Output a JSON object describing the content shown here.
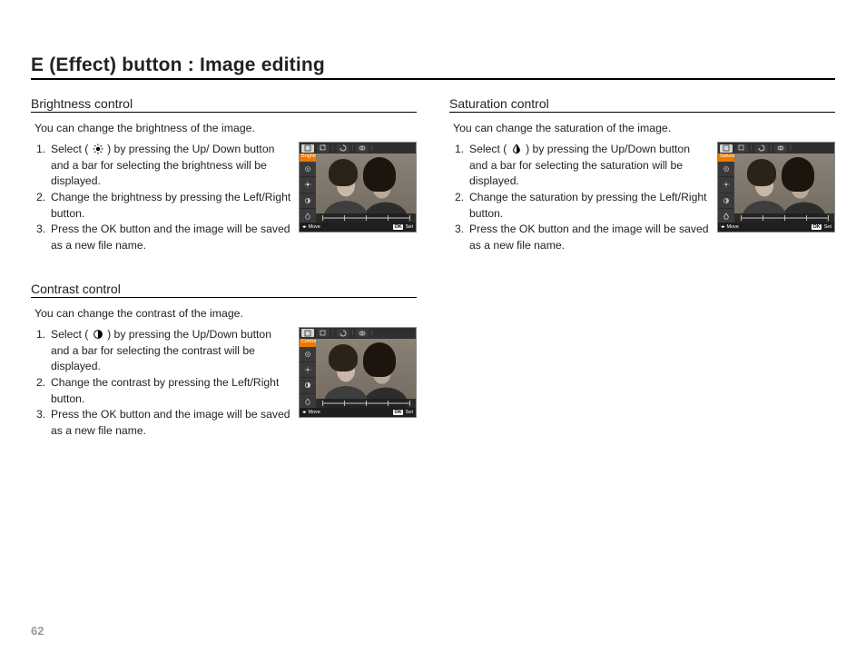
{
  "page": {
    "title": "E (Effect) button : Image editing",
    "number": "62"
  },
  "sections": {
    "brightness": {
      "heading": "Brightness control",
      "intro": "You can change the brightness of the image.",
      "icon_name": "sun-icon",
      "step1_pre": "Select ( ",
      "step1_post": " ) by pressing the Up/ Down button and a bar for selecting the brightness will be displayed.",
      "step2": "Change the brightness by pressing the Left/Right button.",
      "step3": "Press the OK button and the image will be saved as a new file name.",
      "lcd_label": "Brightness"
    },
    "contrast": {
      "heading": "Contrast control",
      "intro": "You can change the contrast of the image.",
      "icon_name": "half-circle-icon",
      "step1_pre": "Select ( ",
      "step1_post": " ) by pressing the Up/Down button and a bar for selecting the contrast will be displayed.",
      "step2": "Change the contrast by pressing the Left/Right button.",
      "step3": "Press the OK button and the image will be saved as a new file name.",
      "lcd_label": "Contrast"
    },
    "saturation": {
      "heading": "Saturation control",
      "intro": "You can change the saturation of the image.",
      "icon_name": "droplet-icon",
      "step1_pre": "Select ( ",
      "step1_post": " ) by pressing the Up/Down button and a bar for selecting the saturation will be displayed.",
      "step2": "Change the saturation by pressing the Left/Right button.",
      "step3": "Press the OK button and the image will be saved as a new file name.",
      "lcd_label": "Saturation"
    }
  },
  "lcd": {
    "tabs": [
      "edit",
      "crop",
      "rotate",
      "effect"
    ],
    "side_icons": [
      "redeye-icon",
      "sun-icon",
      "half-circle-icon",
      "droplet-icon"
    ],
    "scale_ticks": 5,
    "footer": {
      "arrows_label": "Move",
      "ok_label": "OK",
      "set_label": "Set"
    }
  }
}
